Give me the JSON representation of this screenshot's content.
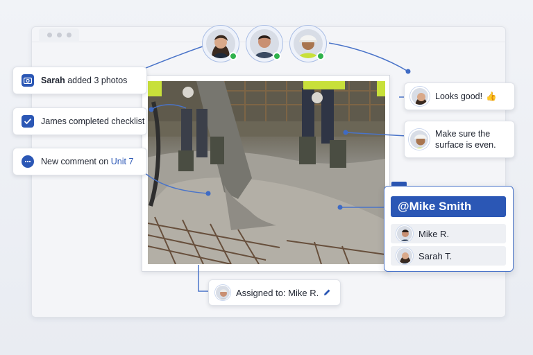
{
  "top_avatars": [
    {
      "name": "woman-avatar",
      "online": true
    },
    {
      "name": "man-avatar",
      "online": true
    },
    {
      "name": "worker-avatar",
      "online": true
    }
  ],
  "notifications": [
    {
      "user": "Sarah",
      "text": "added 3 photos",
      "icon": "photo-icon"
    },
    {
      "text": "James completed checklist",
      "icon": "checkbox-icon"
    },
    {
      "text": "New comment on",
      "link": "Unit 7",
      "icon": "comment-icon"
    }
  ],
  "comments": [
    {
      "text": "Looks good!",
      "emoji": "👍"
    },
    {
      "line1": "Make sure the",
      "line2": "surface is even."
    }
  ],
  "mention": {
    "tag": "@Mike Smith",
    "suggestions": [
      "Mike R.",
      "Sarah T."
    ]
  },
  "assigned": {
    "label": "Assigned to: Mike R.",
    "icon": "pencil-icon"
  },
  "colors": {
    "accent": "#2b57b5",
    "online": "#2fb24c"
  }
}
